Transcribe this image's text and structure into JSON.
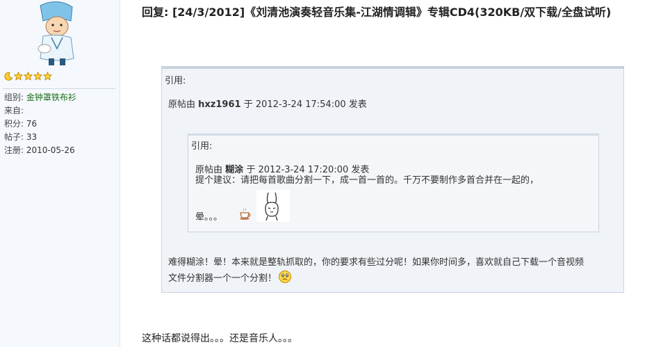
{
  "title": "回复: [24/3/2012]《刘清池演奏轻音乐集-江湖情调辑》专辑CD4(320KB/双下载/全盘试听)",
  "user": {
    "stars": [
      "moon-icon",
      "star-icon",
      "star-icon",
      "star-icon",
      "star-icon"
    ],
    "info": [
      {
        "label": "组别:",
        "value": "金钟罩铁布衫"
      },
      {
        "label": "来自:",
        "value": ""
      },
      {
        "label": "积分:",
        "value": "76"
      },
      {
        "label": "帖子:",
        "value": "33"
      },
      {
        "label": "注册:",
        "value": "2010-05-26"
      }
    ]
  },
  "outer_quote": {
    "label": "引用:",
    "by_prefix": "原帖由",
    "author": "hxz1961",
    "by_suffix": "于 2012-3-24 17:54:00 发表",
    "inner_quote": {
      "label": "引用:",
      "by_prefix": "原帖由",
      "author": "糊涂",
      "by_suffix": "于 2012-3-24 17:20:00 发表",
      "line1": "提个建议：请把每首歌曲分割一下，成一首一首的。千万不要制作多首合并在一起的，",
      "line2": "晕。。。"
    },
    "reply_line1": "难得糊涂！晕！本来就是整轨抓取的，你的要求有些过分呢！如果你时间多，喜欢就自己下载一个音视频",
    "reply_line2": "文件分割器一个一个分割！"
  },
  "footer": "这种话都说得出。。。还是音乐人。。。",
  "colors": {
    "sidebar_bg": "#f5f8fc",
    "quote_bg": "#f0f3f7",
    "quote_border": "#c9d3df",
    "group_green": "#1b6d1b"
  }
}
